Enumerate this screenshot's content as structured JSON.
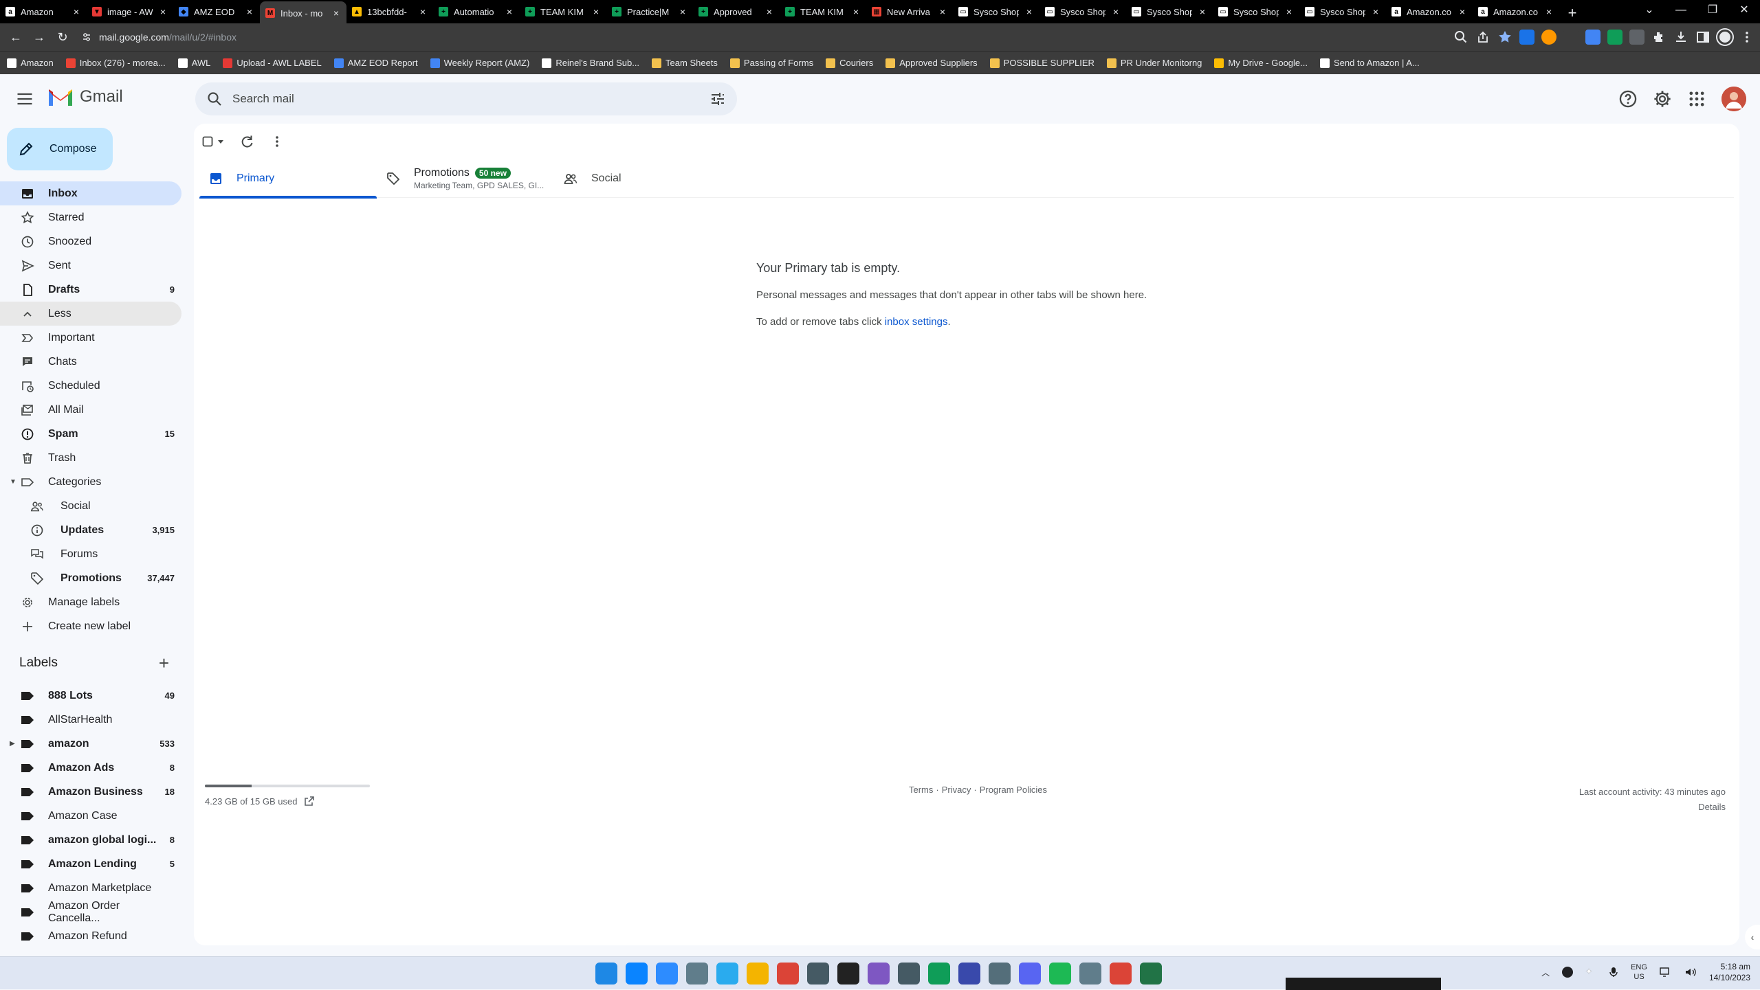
{
  "browser": {
    "tabs": [
      {
        "title": "Amazon",
        "fav": "#ffffff",
        "glyph": "a"
      },
      {
        "title": "image - AW",
        "fav": "#e53935",
        "glyph": "▼"
      },
      {
        "title": "AMZ EOD",
        "fav": "#4285f4",
        "glyph": "◆"
      },
      {
        "title": "Inbox - mo",
        "fav": "#ea4335",
        "glyph": "M"
      },
      {
        "title": "13bcbfdd-",
        "fav": "#fbbc04",
        "glyph": "▲"
      },
      {
        "title": "Automatio",
        "fav": "#0f9d58",
        "glyph": "+"
      },
      {
        "title": "TEAM KIM",
        "fav": "#0f9d58",
        "glyph": "+"
      },
      {
        "title": "Practice|M",
        "fav": "#0f9d58",
        "glyph": "+"
      },
      {
        "title": "Approved",
        "fav": "#0f9d58",
        "glyph": "+"
      },
      {
        "title": "TEAM KIM",
        "fav": "#0f9d58",
        "glyph": "+"
      },
      {
        "title": "New Arriva",
        "fav": "#ea4335",
        "glyph": "▦"
      },
      {
        "title": "Sysco Shop",
        "fav": "#ffffff",
        "glyph": "▭"
      },
      {
        "title": "Sysco Shop",
        "fav": "#ffffff",
        "glyph": "▭"
      },
      {
        "title": "Sysco Shop",
        "fav": "#ffffff",
        "glyph": "▭"
      },
      {
        "title": "Sysco Shop",
        "fav": "#ffffff",
        "glyph": "▭"
      },
      {
        "title": "Sysco Shop",
        "fav": "#ffffff",
        "glyph": "▭"
      },
      {
        "title": "Amazon.co",
        "fav": "#ffffff",
        "glyph": "a"
      },
      {
        "title": "Amazon.co",
        "fav": "#ffffff",
        "glyph": "a"
      }
    ],
    "active_tab": 3,
    "new_tab_label": "+",
    "url_host": "mail.google.com",
    "url_path": "/mail/u/2/#inbox",
    "bookmarks": [
      {
        "label": "Amazon",
        "color": "#ffffff"
      },
      {
        "label": "Inbox (276) - morea...",
        "color": "#ea4335"
      },
      {
        "label": "AWL",
        "color": "#ffffff"
      },
      {
        "label": "Upload - AWL LABEL",
        "color": "#e53935"
      },
      {
        "label": "AMZ EOD Report",
        "color": "#4285f4"
      },
      {
        "label": "Weekly Report (AMZ)",
        "color": "#4285f4"
      },
      {
        "label": "Reinel's Brand Sub...",
        "color": "#ffffff"
      },
      {
        "label": "Team Sheets",
        "color": "#f2c14e"
      },
      {
        "label": "Passing of Forms",
        "color": "#f2c14e"
      },
      {
        "label": "Couriers",
        "color": "#f2c14e"
      },
      {
        "label": "Approved Suppliers",
        "color": "#f2c14e"
      },
      {
        "label": "POSSIBLE SUPPLIER",
        "color": "#f2c14e"
      },
      {
        "label": "PR Under Monitorng",
        "color": "#f2c14e"
      },
      {
        "label": "My Drive - Google...",
        "color": "#fbbc04"
      },
      {
        "label": "Send to Amazon | A...",
        "color": "#ffffff"
      }
    ]
  },
  "gmail": {
    "logo_text": "Gmail",
    "search_placeholder": "Search mail",
    "compose_label": "Compose",
    "nav": [
      {
        "label": "Inbox",
        "count": "",
        "icon": "inbox",
        "selected": true,
        "bold": true
      },
      {
        "label": "Starred",
        "count": "",
        "icon": "star"
      },
      {
        "label": "Snoozed",
        "count": "",
        "icon": "clock"
      },
      {
        "label": "Sent",
        "count": "",
        "icon": "send"
      },
      {
        "label": "Drafts",
        "count": "9",
        "icon": "draft",
        "bold": true
      },
      {
        "label": "Less",
        "count": "",
        "icon": "chevron-up",
        "hover": true
      },
      {
        "label": "Important",
        "count": "",
        "icon": "important"
      },
      {
        "label": "Chats",
        "count": "",
        "icon": "chat"
      },
      {
        "label": "Scheduled",
        "count": "",
        "icon": "scheduled"
      },
      {
        "label": "All Mail",
        "count": "",
        "icon": "allmail"
      },
      {
        "label": "Spam",
        "count": "15",
        "icon": "spam",
        "bold": true
      },
      {
        "label": "Trash",
        "count": "",
        "icon": "trash"
      },
      {
        "label": "Categories",
        "count": "",
        "icon": "label",
        "caret": "down"
      },
      {
        "label": "Social",
        "count": "",
        "icon": "people",
        "sub": true
      },
      {
        "label": "Updates",
        "count": "3,915",
        "icon": "info",
        "sub": true,
        "bold": true
      },
      {
        "label": "Forums",
        "count": "",
        "icon": "forum",
        "sub": true
      },
      {
        "label": "Promotions",
        "count": "37,447",
        "icon": "tag",
        "sub": true,
        "bold": true
      },
      {
        "label": "Manage labels",
        "count": "",
        "icon": "gear"
      },
      {
        "label": "Create new label",
        "count": "",
        "icon": "plus"
      }
    ],
    "labels_heading": "Labels",
    "labels": [
      {
        "label": "888 Lots",
        "count": "49",
        "bold": true
      },
      {
        "label": "AllStarHealth",
        "count": ""
      },
      {
        "label": "amazon",
        "count": "533",
        "bold": true,
        "caret": true
      },
      {
        "label": "Amazon Ads",
        "count": "8",
        "bold": true
      },
      {
        "label": "Amazon Business",
        "count": "18",
        "bold": true
      },
      {
        "label": "Amazon Case",
        "count": ""
      },
      {
        "label": "amazon global logi...",
        "count": "8",
        "bold": true
      },
      {
        "label": "Amazon Lending",
        "count": "5",
        "bold": true
      },
      {
        "label": "Amazon Marketplace",
        "count": ""
      },
      {
        "label": "Amazon Order Cancella...",
        "count": ""
      },
      {
        "label": "Amazon Refund",
        "count": ""
      }
    ],
    "category_tabs": {
      "primary": "Primary",
      "promotions": "Promotions",
      "promotions_badge": "50 new",
      "promotions_snippet": "Marketing Team, GPD SALES, GI...",
      "social": "Social"
    },
    "empty_state": {
      "heading": "Your Primary tab is empty.",
      "line1": "Personal messages and messages that don't appear in other tabs will be shown here.",
      "line2_prefix": "To add or remove tabs click ",
      "line2_link": "inbox settings",
      "line2_suffix": "."
    },
    "footer": {
      "storage_text": "4.23 GB of 15 GB used",
      "storage_fraction": 0.282,
      "terms": "Terms",
      "sep1": "·",
      "privacy": "Privacy",
      "sep2": "·",
      "program_policies": "Program Policies",
      "last_activity": "Last account activity: 43 minutes ago",
      "details": "Details"
    }
  },
  "taskbar": {
    "app_colors": [
      "#1e88e5",
      "#0a84ff",
      "#2d8cff",
      "#607d8b",
      "#2aabee",
      "#f4b400",
      "#db4437",
      "#455a64",
      "#222222",
      "#7e57c2",
      "#455a64",
      "#0f9d58",
      "#3949ab",
      "#546e7a",
      "#5865f2",
      "#1db954",
      "#607d8b",
      "#db4437",
      "#217346"
    ],
    "lang_top": "ENG",
    "lang_bottom": "US",
    "time": "5:18 am",
    "date": "14/10/2023"
  }
}
